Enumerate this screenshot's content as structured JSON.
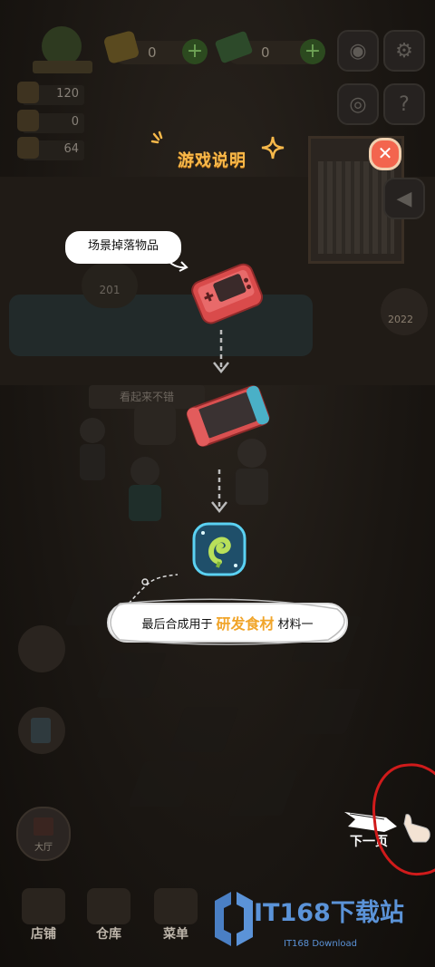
{
  "hud": {
    "coins": "0",
    "cash": "0",
    "stats": [
      "120",
      "0",
      "64"
    ],
    "speech_count": "201",
    "year_badge": "2022",
    "sign_hint": "看起来不错",
    "hall_label": "大厅"
  },
  "tutorial": {
    "title": "游戏说明",
    "bubble_label": "场景掉落物品",
    "note_prefix": "最后合成用于",
    "note_highlight": "研发食材",
    "note_suffix": "材料一",
    "next_label": "下一页"
  },
  "bottom_nav": [
    "店铺",
    "仓库",
    "菜单"
  ],
  "watermark": {
    "title": "IT168下载站",
    "subtitle": "IT168 Download"
  },
  "colors": {
    "title": "#f7b84a",
    "highlight": "#f1a52a",
    "close": "#f3654e",
    "annotation": "#d01b1b",
    "watermark": "#5b93d8"
  }
}
